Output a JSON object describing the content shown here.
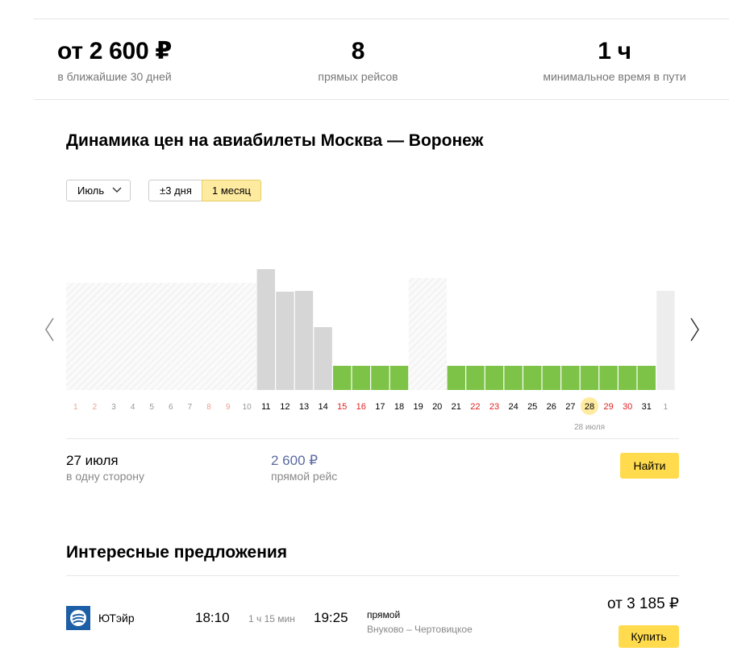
{
  "stats": [
    {
      "value": "от 2 600 ₽",
      "label": "в ближайшие 30 дней"
    },
    {
      "value": "8",
      "label": "прямых рейсов"
    },
    {
      "value": "1 ч",
      "label": "минимальное время в пути"
    }
  ],
  "dynamics": {
    "title": "Динамика цен на авиабилеты Москва — Воронеж",
    "month_select": "Июль",
    "range_options": [
      "±3 дня",
      "1 месяц"
    ],
    "active_range": "1 месяц"
  },
  "chart_data": {
    "type": "bar",
    "categories": [
      "1",
      "2",
      "3",
      "4",
      "5",
      "6",
      "7",
      "8",
      "9",
      "10",
      "11",
      "12",
      "13",
      "14",
      "15",
      "16",
      "17",
      "18",
      "19",
      "20",
      "21",
      "22",
      "23",
      "24",
      "25",
      "26",
      "27",
      "28",
      "29",
      "30",
      "31",
      "1"
    ],
    "values": [
      null,
      null,
      null,
      null,
      null,
      null,
      null,
      null,
      null,
      null,
      150,
      122,
      123,
      78,
      30,
      30,
      30,
      30,
      null,
      null,
      30,
      30,
      30,
      30,
      30,
      30,
      30,
      30,
      30,
      30,
      30,
      null
    ],
    "status": [
      "past",
      "past",
      "past",
      "past",
      "past",
      "past",
      "past",
      "past",
      "past",
      "past",
      "price",
      "price",
      "price",
      "price",
      "min",
      "min",
      "min",
      "min",
      "none",
      "none",
      "min",
      "min",
      "min",
      "min",
      "min",
      "min",
      "min",
      "min",
      "min",
      "min",
      "min",
      "unknown"
    ],
    "weekend_days": [
      1,
      2,
      8,
      9,
      15,
      16,
      22,
      23,
      29,
      30
    ],
    "selected_index": 27,
    "selected_label": "28 июля",
    "colors": {
      "min": "#7dc347",
      "price": "#d6d6d6",
      "unknown": "#ededed",
      "weekend": "#e21f1f",
      "weekend_past": "#f0a090",
      "day": "#000000",
      "day_past": "#999999",
      "selected_bg": "#ffeba0"
    }
  },
  "selection": {
    "date": "27 июля",
    "direction": "в одну сторону",
    "price": "2 600 ₽",
    "flight_type": "прямой рейс",
    "find_label": "Найти"
  },
  "offers": {
    "title": "Интересные предложения",
    "items": [
      {
        "airline": "ЮТэйр",
        "depart": "18:10",
        "duration": "1 ч 15 мин",
        "arrive": "19:25",
        "type": "прямой",
        "route": "Внуково – Чертовицкое",
        "price": "от 3 185 ₽",
        "buy_label": "Купить"
      }
    ]
  }
}
